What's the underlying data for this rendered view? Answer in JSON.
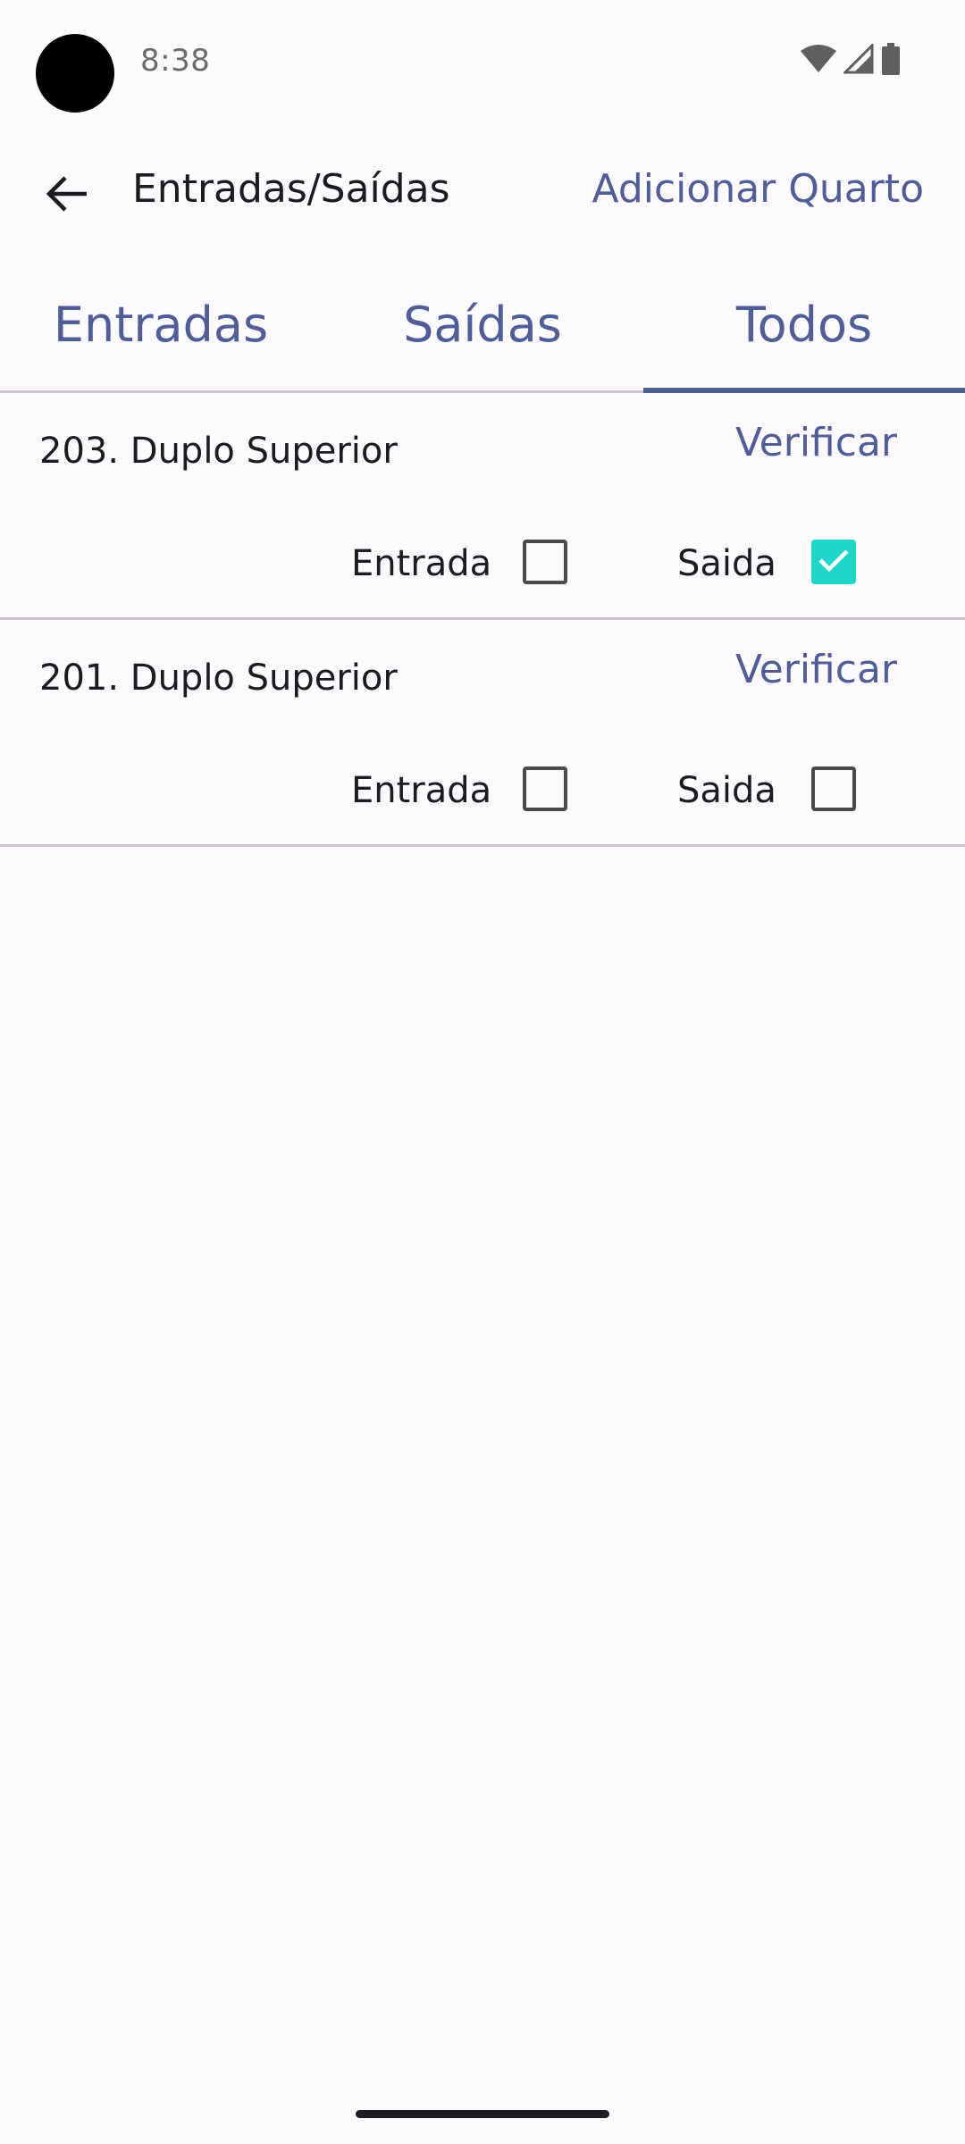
{
  "status_bar": {
    "time": "8:38",
    "icons": [
      "wifi-icon",
      "signal-icon",
      "battery-icon"
    ]
  },
  "app_bar": {
    "back_icon": "arrow-back-icon",
    "title": "Entradas/Saídas",
    "action_label": "Adicionar Quarto"
  },
  "tabs": [
    {
      "label": "Entradas",
      "selected": false
    },
    {
      "label": "Saídas",
      "selected": false
    },
    {
      "label": "Todos",
      "selected": true
    }
  ],
  "rooms": [
    {
      "name": "203. Duplo Superior",
      "verify_label": "Verificar",
      "entrada_label": "Entrada",
      "entrada_checked": false,
      "saida_label": "Saida",
      "saida_checked": true
    },
    {
      "name": "201. Duplo Superior",
      "verify_label": "Verificar",
      "entrada_label": "Entrada",
      "entrada_checked": false,
      "saida_label": "Saida",
      "saida_checked": false
    }
  ],
  "colors": {
    "accent": "#4F5E97",
    "checkbox_checked": "#1ED5C8",
    "background": "#FCFAFD",
    "divider": "#CAC4D0"
  }
}
